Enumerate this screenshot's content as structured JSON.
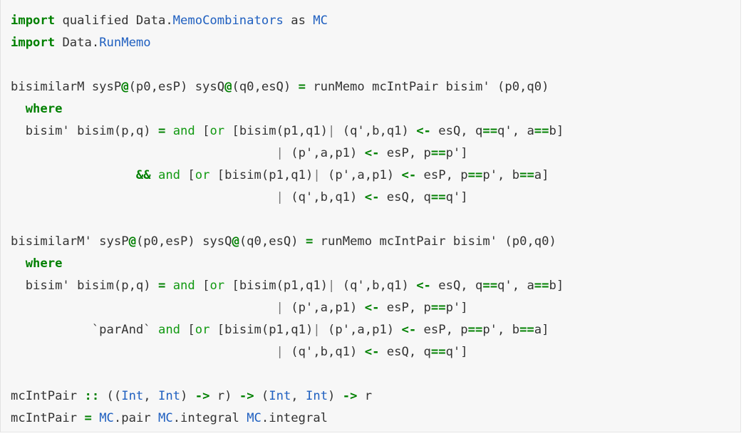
{
  "document": {
    "kind": "code-block",
    "language": "haskell",
    "background_color": "#f7f7f7",
    "border_color": "#e6e6e6",
    "colors": {
      "keyword": "#008000",
      "operator": "#008000",
      "function": "#119911",
      "type": "#2060c0",
      "plain": "#333333",
      "pipe": "#777777"
    }
  },
  "code": {
    "lines": [
      {
        "id": "line-1",
        "tokens": [
          {
            "t": "import",
            "c": "kw"
          },
          {
            "t": " qualified ",
            "c": "pln"
          },
          {
            "t": "Data.",
            "c": "pln"
          },
          {
            "t": "MemoCombinators",
            "c": "typ"
          },
          {
            "t": " as ",
            "c": "pln"
          },
          {
            "t": "MC",
            "c": "typ"
          }
        ]
      },
      {
        "id": "line-2",
        "tokens": [
          {
            "t": "import",
            "c": "kw"
          },
          {
            "t": " Data.",
            "c": "pln"
          },
          {
            "t": "RunMemo",
            "c": "typ"
          }
        ]
      },
      {
        "id": "line-3",
        "tokens": []
      },
      {
        "id": "line-4",
        "tokens": [
          {
            "t": "bisimilarM sysP",
            "c": "pln"
          },
          {
            "t": "@",
            "c": "op"
          },
          {
            "t": "(p0,esP) sysQ",
            "c": "pln"
          },
          {
            "t": "@",
            "c": "op"
          },
          {
            "t": "(q0,esQ) ",
            "c": "pln"
          },
          {
            "t": "=",
            "c": "op"
          },
          {
            "t": " runMemo mcIntPair bisim' (p0,q0)",
            "c": "pln"
          }
        ]
      },
      {
        "id": "line-5",
        "tokens": [
          {
            "t": "  ",
            "c": "pln"
          },
          {
            "t": "where",
            "c": "kw"
          }
        ]
      },
      {
        "id": "line-6",
        "tokens": [
          {
            "t": "  bisim' bisim(p,q) ",
            "c": "pln"
          },
          {
            "t": "=",
            "c": "op"
          },
          {
            "t": " ",
            "c": "pln"
          },
          {
            "t": "and",
            "c": "fn"
          },
          {
            "t": " [",
            "c": "pln"
          },
          {
            "t": "or",
            "c": "fn"
          },
          {
            "t": " [bisim(p1,q1)",
            "c": "pln"
          },
          {
            "t": "|",
            "c": "pipe"
          },
          {
            "t": " (q',b,q1) ",
            "c": "pln"
          },
          {
            "t": "<-",
            "c": "op"
          },
          {
            "t": " esQ, q",
            "c": "pln"
          },
          {
            "t": "==",
            "c": "op"
          },
          {
            "t": "q', a",
            "c": "pln"
          },
          {
            "t": "==",
            "c": "op"
          },
          {
            "t": "b]",
            "c": "pln"
          }
        ]
      },
      {
        "id": "line-7",
        "tokens": [
          {
            "t": "                                    ",
            "c": "pln"
          },
          {
            "t": "|",
            "c": "pipe"
          },
          {
            "t": " (p',a,p1) ",
            "c": "pln"
          },
          {
            "t": "<-",
            "c": "op"
          },
          {
            "t": " esP, p",
            "c": "pln"
          },
          {
            "t": "==",
            "c": "op"
          },
          {
            "t": "p']",
            "c": "pln"
          }
        ]
      },
      {
        "id": "line-8",
        "tokens": [
          {
            "t": "                 ",
            "c": "pln"
          },
          {
            "t": "&&",
            "c": "op"
          },
          {
            "t": " ",
            "c": "pln"
          },
          {
            "t": "and",
            "c": "fn"
          },
          {
            "t": " [",
            "c": "pln"
          },
          {
            "t": "or",
            "c": "fn"
          },
          {
            "t": " [bisim(p1,q1)",
            "c": "pln"
          },
          {
            "t": "|",
            "c": "pipe"
          },
          {
            "t": " (p',a,p1) ",
            "c": "pln"
          },
          {
            "t": "<-",
            "c": "op"
          },
          {
            "t": " esP, p",
            "c": "pln"
          },
          {
            "t": "==",
            "c": "op"
          },
          {
            "t": "p', b",
            "c": "pln"
          },
          {
            "t": "==",
            "c": "op"
          },
          {
            "t": "a]",
            "c": "pln"
          }
        ]
      },
      {
        "id": "line-9",
        "tokens": [
          {
            "t": "                                    ",
            "c": "pln"
          },
          {
            "t": "|",
            "c": "pipe"
          },
          {
            "t": " (q',b,q1) ",
            "c": "pln"
          },
          {
            "t": "<-",
            "c": "op"
          },
          {
            "t": " esQ, q",
            "c": "pln"
          },
          {
            "t": "==",
            "c": "op"
          },
          {
            "t": "q']",
            "c": "pln"
          }
        ]
      },
      {
        "id": "line-10",
        "tokens": []
      },
      {
        "id": "line-11",
        "tokens": [
          {
            "t": "bisimilarM' sysP",
            "c": "pln"
          },
          {
            "t": "@",
            "c": "op"
          },
          {
            "t": "(p0,esP) sysQ",
            "c": "pln"
          },
          {
            "t": "@",
            "c": "op"
          },
          {
            "t": "(q0,esQ) ",
            "c": "pln"
          },
          {
            "t": "=",
            "c": "op"
          },
          {
            "t": " runMemo mcIntPair bisim' (p0,q0)",
            "c": "pln"
          }
        ]
      },
      {
        "id": "line-12",
        "tokens": [
          {
            "t": "  ",
            "c": "pln"
          },
          {
            "t": "where",
            "c": "kw"
          }
        ]
      },
      {
        "id": "line-13",
        "tokens": [
          {
            "t": "  bisim' bisim(p,q) ",
            "c": "pln"
          },
          {
            "t": "=",
            "c": "op"
          },
          {
            "t": " ",
            "c": "pln"
          },
          {
            "t": "and",
            "c": "fn"
          },
          {
            "t": " [",
            "c": "pln"
          },
          {
            "t": "or",
            "c": "fn"
          },
          {
            "t": " [bisim(p1,q1)",
            "c": "pln"
          },
          {
            "t": "|",
            "c": "pipe"
          },
          {
            "t": " (q',b,q1) ",
            "c": "pln"
          },
          {
            "t": "<-",
            "c": "op"
          },
          {
            "t": " esQ, q",
            "c": "pln"
          },
          {
            "t": "==",
            "c": "op"
          },
          {
            "t": "q', a",
            "c": "pln"
          },
          {
            "t": "==",
            "c": "op"
          },
          {
            "t": "b]",
            "c": "pln"
          }
        ]
      },
      {
        "id": "line-14",
        "tokens": [
          {
            "t": "                                    ",
            "c": "pln"
          },
          {
            "t": "|",
            "c": "pipe"
          },
          {
            "t": " (p',a,p1) ",
            "c": "pln"
          },
          {
            "t": "<-",
            "c": "op"
          },
          {
            "t": " esP, p",
            "c": "pln"
          },
          {
            "t": "==",
            "c": "op"
          },
          {
            "t": "p']",
            "c": "pln"
          }
        ]
      },
      {
        "id": "line-15",
        "tokens": [
          {
            "t": "           `parAnd` ",
            "c": "pln"
          },
          {
            "t": "and",
            "c": "fn"
          },
          {
            "t": " [",
            "c": "pln"
          },
          {
            "t": "or",
            "c": "fn"
          },
          {
            "t": " [bisim(p1,q1)",
            "c": "pln"
          },
          {
            "t": "|",
            "c": "pipe"
          },
          {
            "t": " (p',a,p1) ",
            "c": "pln"
          },
          {
            "t": "<-",
            "c": "op"
          },
          {
            "t": " esP, p",
            "c": "pln"
          },
          {
            "t": "==",
            "c": "op"
          },
          {
            "t": "p', b",
            "c": "pln"
          },
          {
            "t": "==",
            "c": "op"
          },
          {
            "t": "a]",
            "c": "pln"
          }
        ]
      },
      {
        "id": "line-16",
        "tokens": [
          {
            "t": "                                    ",
            "c": "pln"
          },
          {
            "t": "|",
            "c": "pipe"
          },
          {
            "t": " (q',b,q1) ",
            "c": "pln"
          },
          {
            "t": "<-",
            "c": "op"
          },
          {
            "t": " esQ, q",
            "c": "pln"
          },
          {
            "t": "==",
            "c": "op"
          },
          {
            "t": "q']",
            "c": "pln"
          }
        ]
      },
      {
        "id": "line-17",
        "tokens": []
      },
      {
        "id": "line-18",
        "tokens": [
          {
            "t": "mcIntPair ",
            "c": "pln"
          },
          {
            "t": "::",
            "c": "op"
          },
          {
            "t": " ((",
            "c": "pln"
          },
          {
            "t": "Int",
            "c": "typ"
          },
          {
            "t": ", ",
            "c": "pln"
          },
          {
            "t": "Int",
            "c": "typ"
          },
          {
            "t": ") ",
            "c": "pln"
          },
          {
            "t": "->",
            "c": "op"
          },
          {
            "t": " r) ",
            "c": "pln"
          },
          {
            "t": "->",
            "c": "op"
          },
          {
            "t": " (",
            "c": "pln"
          },
          {
            "t": "Int",
            "c": "typ"
          },
          {
            "t": ", ",
            "c": "pln"
          },
          {
            "t": "Int",
            "c": "typ"
          },
          {
            "t": ") ",
            "c": "pln"
          },
          {
            "t": "->",
            "c": "op"
          },
          {
            "t": " r",
            "c": "pln"
          }
        ]
      },
      {
        "id": "line-19",
        "tokens": [
          {
            "t": "mcIntPair ",
            "c": "pln"
          },
          {
            "t": "=",
            "c": "op"
          },
          {
            "t": " ",
            "c": "pln"
          },
          {
            "t": "MC",
            "c": "typ"
          },
          {
            "t": ".pair ",
            "c": "pln"
          },
          {
            "t": "MC",
            "c": "typ"
          },
          {
            "t": ".integral ",
            "c": "pln"
          },
          {
            "t": "MC",
            "c": "typ"
          },
          {
            "t": ".integral",
            "c": "pln"
          }
        ]
      }
    ]
  }
}
